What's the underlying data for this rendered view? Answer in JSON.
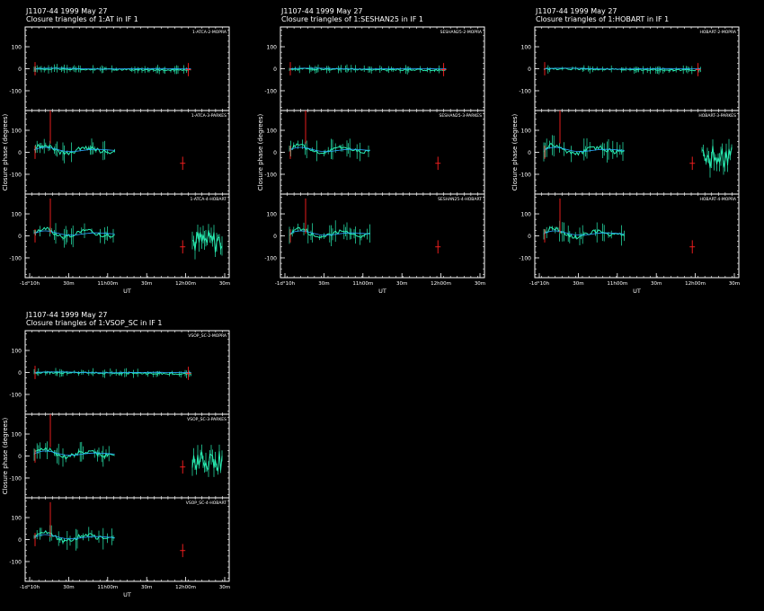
{
  "colors": {
    "background": "#000000",
    "axes": "#ffffff",
    "data": "#29f0b4",
    "model": "#2aa8ff",
    "flagged": "#ff2020"
  },
  "chart_data": [
    {
      "type": "line",
      "source": "J1107-44   1999 May 27",
      "title": "Closure triangles of 1:AT in IF 1",
      "xlabel": "UT",
      "ylabel": "Closure phase   (degrees)",
      "yticks": [
        -100,
        0,
        100
      ],
      "ylim": [
        -190,
        190
      ],
      "xticks": [
        "-1d°10h",
        "30m",
        "11h00m",
        "30m",
        "12h00m",
        "30m"
      ],
      "panels": [
        {
          "label": "1-ATCA-2-MOPRA",
          "flagged_at": 0.98,
          "right_segment": false
        },
        {
          "label": "1-ATCA-3-PARKES",
          "flagged_at": 0.93,
          "right_segment": false
        },
        {
          "label": "1-ATCA-4-HOBART",
          "flagged_at": 0.93,
          "right_segment": true
        }
      ]
    },
    {
      "type": "line",
      "source": "J1107-44   1999 May 27",
      "title": "Closure triangles of 1:SESHAN25 in IF 1",
      "xlabel": "UT",
      "ylabel": "Closure phase   (degrees)",
      "yticks": [
        -100,
        0,
        100
      ],
      "ylim": [
        -190,
        190
      ],
      "xticks": [
        "-1d°10h",
        "30m",
        "11h00m",
        "30m",
        "12h00m",
        "30m"
      ],
      "panels": [
        {
          "label": "SESHAN25-2-MOPRA",
          "flagged_at": 0.98,
          "right_segment": false
        },
        {
          "label": "SESHAN25-3-PARKES",
          "flagged_at": 0.93,
          "right_segment": false
        },
        {
          "label": "SESHAN25-4-HOBART",
          "flagged_at": 0.93,
          "right_segment": false
        }
      ]
    },
    {
      "type": "line",
      "source": "J1107-44   1999 May 27",
      "title": "Closure triangles of 1:HOBART in IF 1",
      "xlabel": "UT",
      "ylabel": "Closure phase   (degrees)",
      "yticks": [
        -100,
        0,
        100
      ],
      "ylim": [
        -190,
        190
      ],
      "xticks": [
        "-1d°10h",
        "30m",
        "11h00m",
        "30m",
        "12h00m",
        "30m"
      ],
      "panels": [
        {
          "label": "HOBART-2-MOPRA",
          "flagged_at": 0.98,
          "right_segment": false
        },
        {
          "label": "HOBART-3-PARKES",
          "flagged_at": 0.93,
          "right_segment": true
        },
        {
          "label": "HOBART-4-MOPRA",
          "flagged_at": 0.93,
          "right_segment": false
        }
      ]
    },
    {
      "type": "line",
      "source": "J1107-44   1999 May 27",
      "title": "Closure triangles of 1:VSOP_SC in IF 1",
      "xlabel": "UT",
      "ylabel": "Closure phase   (degrees)",
      "yticks": [
        -100,
        0,
        100
      ],
      "ylim": [
        -190,
        190
      ],
      "xticks": [
        "-1d°10h",
        "30m",
        "11h00m",
        "30m",
        "12h00m",
        "30m"
      ],
      "panels": [
        {
          "label": "VSOP_SC-2-MOPRA",
          "flagged_at": 0.93,
          "right_segment": false
        },
        {
          "label": "VSOP_SC-3-PARKES",
          "flagged_at": 0.93,
          "right_segment": true
        },
        {
          "label": "VSOP_SC-4-HOBART",
          "flagged_at": 0.93,
          "right_segment": false
        }
      ]
    }
  ]
}
